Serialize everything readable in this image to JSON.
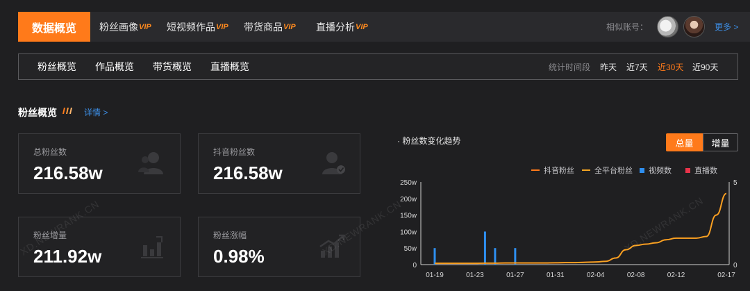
{
  "topnav": {
    "active_tab": "数据概览",
    "tabs": [
      {
        "label": "粉丝画像",
        "vip": "VIP"
      },
      {
        "label": "短视频作品",
        "vip": "VIP"
      },
      {
        "label": "带货商品",
        "vip": "VIP"
      },
      {
        "label": "直播分析",
        "vip": "VIP"
      }
    ],
    "similar_label": "相似账号：",
    "more": "更多 >"
  },
  "subnav": {
    "tabs": [
      "粉丝概览",
      "作品概览",
      "带货概览",
      "直播概览"
    ],
    "range_label": "统计时间段",
    "ranges": [
      "昨天",
      "近7天",
      "近30天",
      "近90天"
    ],
    "active_range": "近30天"
  },
  "section": {
    "title": "粉丝概览",
    "detail": "详情 >"
  },
  "cards": [
    {
      "label": "总粉丝数",
      "value": "216.58w"
    },
    {
      "label": "抖音粉丝数",
      "value": "216.58w"
    },
    {
      "label": "粉丝增量",
      "value": "211.92w"
    },
    {
      "label": "粉丝涨幅",
      "value": "0.98%"
    }
  ],
  "chart": {
    "title": "粉丝数变化趋势",
    "toggle_total": "总量",
    "toggle_increment": "增量",
    "legend": [
      {
        "name": "抖音粉丝",
        "color": "#ff7a1a"
      },
      {
        "name": "全平台粉丝",
        "color": "#f5a623"
      },
      {
        "name": "视频数",
        "color": "#2e8ff0"
      },
      {
        "name": "直播数",
        "color": "#e8334a"
      }
    ]
  },
  "watermark": "XD.NEWRANK.CN",
  "chart_data": {
    "type": "line",
    "x": [
      "01-19",
      "01-20",
      "01-21",
      "01-22",
      "01-23",
      "01-24",
      "01-25",
      "01-26",
      "01-27",
      "01-28",
      "01-29",
      "01-30",
      "01-31",
      "02-01",
      "02-02",
      "02-03",
      "02-04",
      "02-05",
      "02-06",
      "02-07",
      "02-08",
      "02-09",
      "02-10",
      "02-11",
      "02-12",
      "02-13",
      "02-14",
      "02-15",
      "02-16",
      "02-17"
    ],
    "x_tick_labels": [
      "01-19",
      "01-23",
      "01-27",
      "01-31",
      "02-04",
      "02-08",
      "02-12",
      "02-17"
    ],
    "ylim": [
      0,
      250
    ],
    "y_tick_labels": [
      "0",
      "50w",
      "100w",
      "150w",
      "200w",
      "250w"
    ],
    "y2lim": [
      0,
      5
    ],
    "y2_tick_labels": [
      "0",
      "5"
    ],
    "series": [
      {
        "name": "抖音粉丝",
        "axis": "left",
        "kind": "line",
        "values": [
          4,
          4,
          4,
          4,
          4,
          4.5,
          4.5,
          5,
          5,
          5,
          5,
          5,
          5.5,
          6,
          6,
          7,
          8,
          10,
          20,
          45,
          58,
          62,
          66,
          75,
          80,
          80,
          80,
          85,
          150,
          215
        ]
      },
      {
        "name": "全平台粉丝",
        "axis": "left",
        "kind": "line",
        "values": [
          4,
          4,
          4,
          4,
          4,
          4.5,
          4.5,
          5,
          5,
          5,
          5,
          5,
          5.5,
          6,
          6,
          7,
          8,
          10,
          20,
          45,
          58,
          62,
          66,
          75,
          80,
          80,
          80,
          85,
          150,
          215
        ]
      },
      {
        "name": "视频数",
        "axis": "right",
        "kind": "bar",
        "values": [
          1,
          0,
          0,
          0,
          0,
          2,
          1,
          0,
          1,
          0,
          0,
          0,
          0,
          0,
          0,
          0,
          0,
          0,
          0,
          0,
          0,
          0,
          0,
          0,
          0,
          0,
          0,
          0,
          0,
          0
        ]
      },
      {
        "name": "直播数",
        "axis": "right",
        "kind": "bar",
        "values": [
          0,
          0,
          0,
          0,
          0,
          0,
          0,
          0,
          0,
          0,
          0,
          0,
          0,
          0,
          0,
          0,
          0,
          0,
          0,
          0,
          0,
          0,
          0,
          0,
          0,
          0,
          0,
          0,
          0,
          0
        ]
      }
    ],
    "grid": false,
    "legend_position": "top-right"
  }
}
